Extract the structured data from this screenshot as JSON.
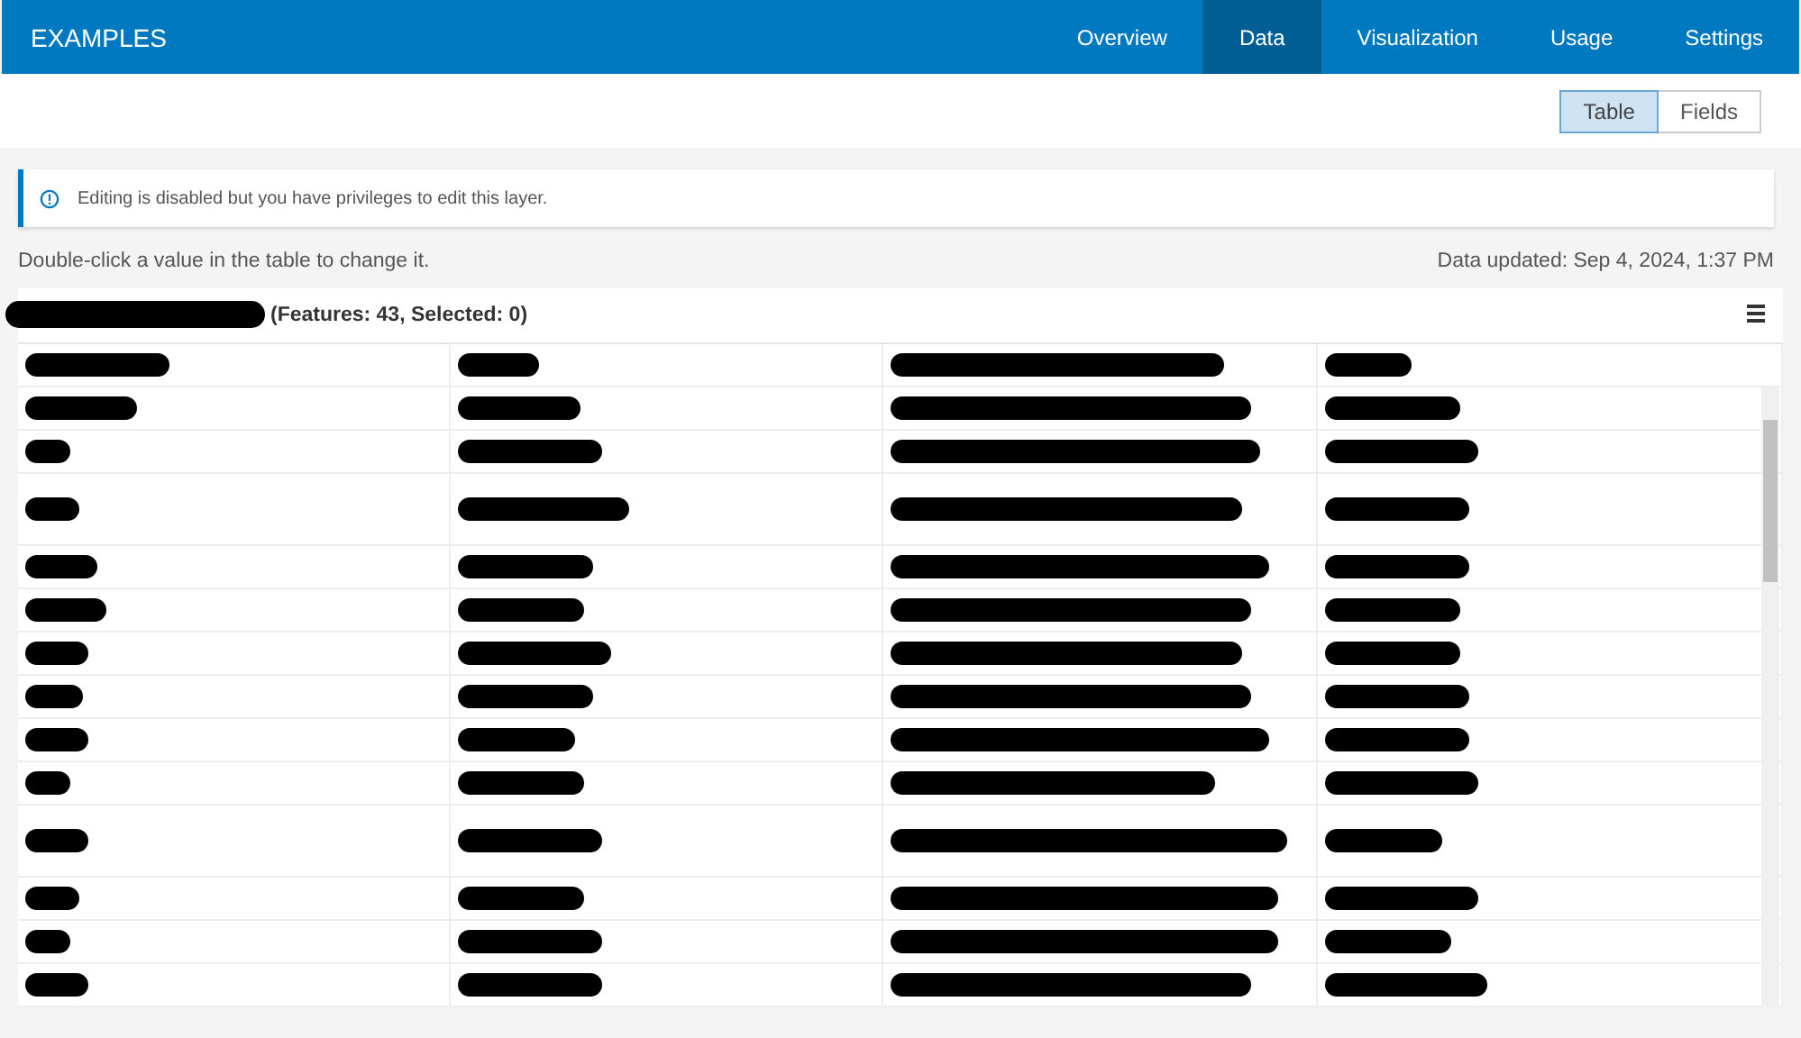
{
  "header": {
    "title": "EXAMPLES",
    "tabs": [
      {
        "label": "Overview",
        "selected": false
      },
      {
        "label": "Data",
        "selected": true
      },
      {
        "label": "Visualization",
        "selected": false
      },
      {
        "label": "Usage",
        "selected": false
      },
      {
        "label": "Settings",
        "selected": false
      }
    ]
  },
  "view_toggle": [
    {
      "label": "Table",
      "selected": true
    },
    {
      "label": "Fields",
      "selected": false
    }
  ],
  "banner": {
    "text": "Editing is disabled but you have privileges to edit this layer."
  },
  "hint": "Double-click a value in the table to change it.",
  "updated": "Data updated: Sep 4, 2024, 1:37 PM",
  "table": {
    "summary": "(Features: 43, Selected: 0)"
  }
}
